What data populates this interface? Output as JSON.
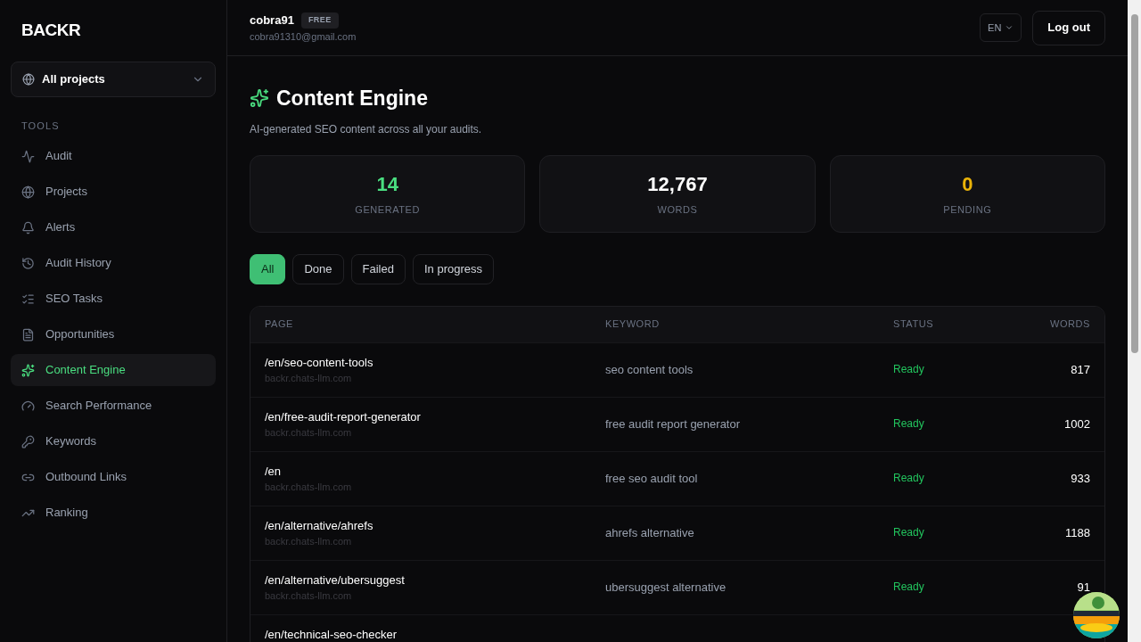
{
  "brand": "BACKR",
  "project_select": {
    "value": "All projects"
  },
  "sidebar": {
    "section": "TOOLS",
    "items": [
      {
        "label": "Audit",
        "kind": "activity",
        "selected": false
      },
      {
        "label": "Projects",
        "kind": "globe",
        "selected": false
      },
      {
        "label": "Alerts",
        "kind": "bell",
        "selected": false
      },
      {
        "label": "Audit History",
        "kind": "history",
        "selected": false
      },
      {
        "label": "SEO Tasks",
        "kind": "list",
        "selected": false
      },
      {
        "label": "Opportunities",
        "kind": "file",
        "selected": false
      },
      {
        "label": "Content Engine",
        "kind": "sparkles",
        "selected": true
      },
      {
        "label": "Search Performance",
        "kind": "gauge",
        "selected": false
      },
      {
        "label": "Keywords",
        "kind": "key",
        "selected": false
      },
      {
        "label": "Outbound Links",
        "kind": "link",
        "selected": false
      },
      {
        "label": "Ranking",
        "kind": "trend",
        "selected": false
      }
    ]
  },
  "user": {
    "name": "cobra91",
    "plan": "FREE",
    "email": "cobra91310@gmail.com"
  },
  "language": "EN",
  "logout": "Log out",
  "page": {
    "title": "Content Engine",
    "subtitle": "AI-generated SEO content across all your audits."
  },
  "stats": [
    {
      "value": "14",
      "label": "GENERATED",
      "color": "#4ade80"
    },
    {
      "value": "12,767",
      "label": "WORDS",
      "color": "#ffffff"
    },
    {
      "value": "0",
      "label": "PENDING",
      "color": "#eab308"
    }
  ],
  "filters": [
    {
      "label": "All",
      "selected": true
    },
    {
      "label": "Done",
      "selected": false
    },
    {
      "label": "Failed",
      "selected": false
    },
    {
      "label": "In progress",
      "selected": false
    }
  ],
  "table": {
    "columns": [
      "PAGE",
      "KEYWORD",
      "STATUS",
      "WORDS"
    ],
    "rows": [
      {
        "page": "/en/seo-content-tools",
        "domain": "backr.chats-llm.com",
        "keyword": "seo content tools",
        "status": "Ready",
        "words": "817"
      },
      {
        "page": "/en/free-audit-report-generator",
        "domain": "backr.chats-llm.com",
        "keyword": "free audit report generator",
        "status": "Ready",
        "words": "1002"
      },
      {
        "page": "/en",
        "domain": "backr.chats-llm.com",
        "keyword": "free seo audit tool",
        "status": "Ready",
        "words": "933"
      },
      {
        "page": "/en/alternative/ahrefs",
        "domain": "backr.chats-llm.com",
        "keyword": "ahrefs alternative",
        "status": "Ready",
        "words": "1188"
      },
      {
        "page": "/en/alternative/ubersuggest",
        "domain": "backr.chats-llm.com",
        "keyword": "ubersuggest alternative",
        "status": "Ready",
        "words": "91"
      },
      {
        "page": "/en/technical-seo-checker"
      }
    ]
  }
}
